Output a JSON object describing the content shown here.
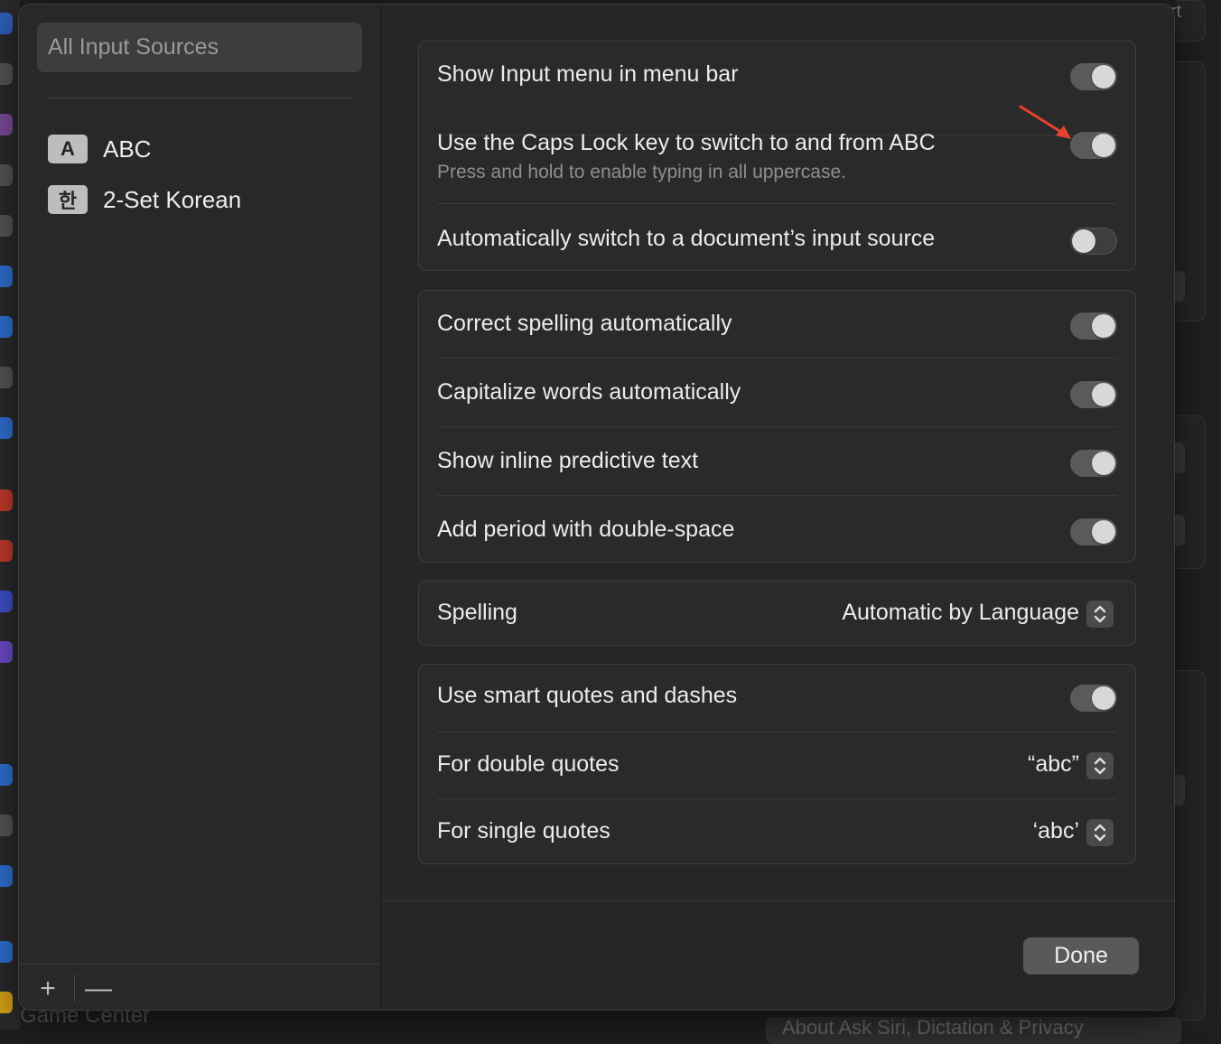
{
  "colors": {
    "annotation_arrow": "#e8412f"
  },
  "sidebar": {
    "search_placeholder": "All Input Sources",
    "sources": [
      {
        "badge": "A",
        "label": "ABC"
      },
      {
        "badge": "한",
        "label": "2-Set Korean"
      }
    ],
    "add_label": "+",
    "remove_label": "—"
  },
  "main": {
    "group1": {
      "show_input_menu": {
        "label": "Show Input menu in menu bar",
        "on": true
      },
      "caps_lock": {
        "label": "Use the Caps Lock key to switch to and from ABC",
        "subtitle": "Press and hold to enable typing in all uppercase.",
        "on": true
      },
      "auto_switch": {
        "label": "Automatically switch to a document’s input source",
        "on": false
      }
    },
    "group2": {
      "correct_spelling": {
        "label": "Correct spelling automatically",
        "on": true
      },
      "capitalize_words": {
        "label": "Capitalize words automatically",
        "on": true
      },
      "predictive_text": {
        "label": "Show inline predictive text",
        "on": true
      },
      "period_double_space": {
        "label": "Add period with double-space",
        "on": true
      }
    },
    "spelling": {
      "label": "Spelling",
      "value": "Automatic by Language"
    },
    "group4": {
      "smart_quotes": {
        "label": "Use smart quotes and dashes",
        "on": true
      },
      "double_quotes": {
        "label": "For double quotes",
        "value": "“abc”"
      },
      "single_quotes": {
        "label": "For single quotes",
        "value": "‘abc’"
      }
    },
    "done_label": "Done"
  },
  "background": {
    "bottom_left_text": "Game Center",
    "bottom_right_text": "About Ask Siri, Dictation & Privacy",
    "corner_text": "rt"
  }
}
